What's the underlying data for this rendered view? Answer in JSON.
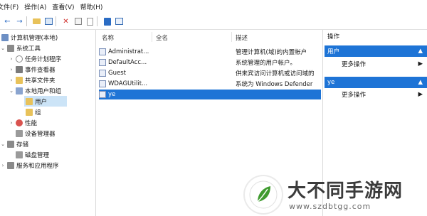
{
  "menu": [
    "文件(F)",
    "操作(A)",
    "查看(V)",
    "帮助(H)"
  ],
  "tree": {
    "root": "计算机管理(本地)",
    "system_tools": "系统工具",
    "task_scheduler": "任务计划程序",
    "event_viewer": "事件查看器",
    "shared_folders": "共享文件夹",
    "local_users_groups": "本地用户和组",
    "users": "用户",
    "groups": "组",
    "performance": "性能",
    "device_manager": "设备管理器",
    "storage": "存储",
    "disk_management": "磁盘管理",
    "services_apps": "服务和应用程序"
  },
  "list": {
    "col_name": "名称",
    "col_fullname": "全名",
    "col_desc": "描述",
    "rows": [
      {
        "name": "Administrat...",
        "desc": "管理计算机(域)的内置帐户"
      },
      {
        "name": "DefaultAcc...",
        "desc": "系统管理的用户帐户。"
      },
      {
        "name": "Guest",
        "desc": "供来宾访问计算机或访问域的"
      },
      {
        "name": "WDAGUtilit...",
        "desc": "系统为 Windows Defender"
      },
      {
        "name": "ye",
        "desc": ""
      }
    ]
  },
  "actions": {
    "title": "操作",
    "section1": "用户",
    "more1": "更多操作",
    "section2": "ye",
    "more2": "更多操作"
  },
  "watermark": {
    "title": "大不同手游网",
    "url": "www.szdbtgg.com"
  },
  "colors": {
    "selection": "#1e74d6",
    "tree_selection": "#cce4f7",
    "logo_green": "#3f9b2f"
  }
}
